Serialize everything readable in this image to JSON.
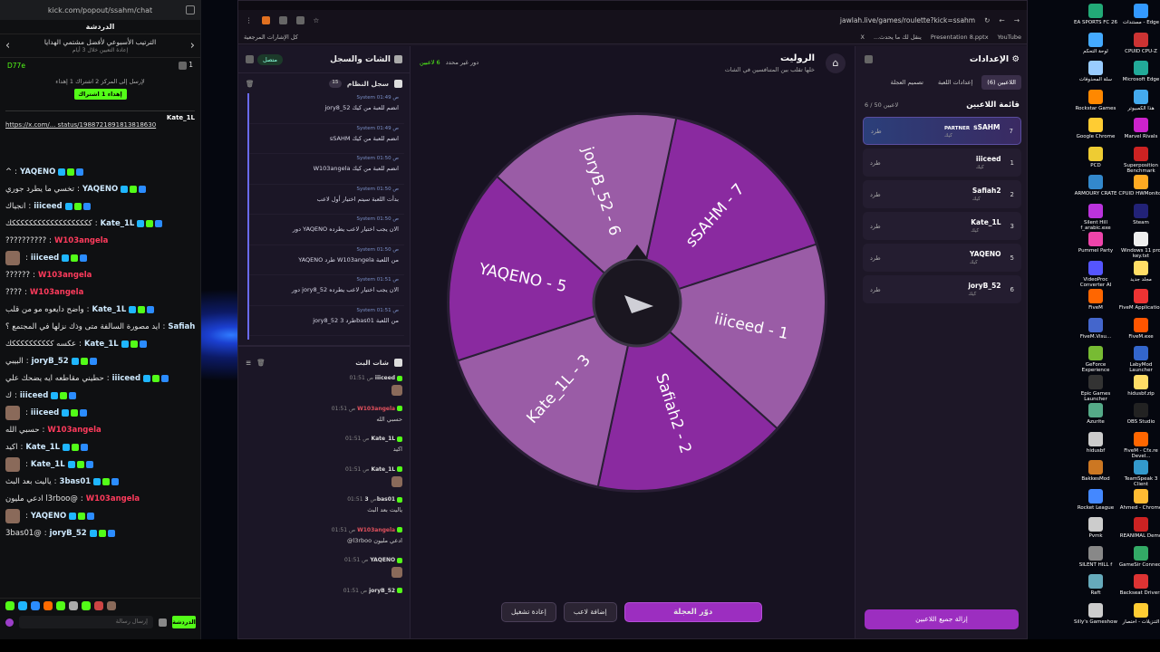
{
  "kick": {
    "url": "kick.com/popout/ssahm/chat",
    "header": "الدردشة",
    "pinned_title": "الترتيب الأسبوعي لأفضل مشتمي الهدايا",
    "pinned_sub": "إعادة التعيين خلال 3 أيام",
    "coin_count": "1",
    "streamer_tag": "D77e",
    "rank_msg": "لإرسل إلى المركز 2 اشتراك 1 إهداء",
    "join_label": "إهداء 1 اشتراك",
    "pinned_user": "Kate_1L",
    "pinned_link": "https://x.com/... status/1988721891813818630",
    "messages": [
      {
        "user": "YAQENO",
        "text": "^",
        "red": false
      },
      {
        "user": "YAQENO",
        "text": "تخسي ما يطرد جوري",
        "red": false
      },
      {
        "user": "iiiceed",
        "text": "انجياك",
        "red": false
      },
      {
        "user": "Kate_1L",
        "text": "كككككككككككككككككككك",
        "red": false
      },
      {
        "user": "W103angela",
        "text": "??????????",
        "red": true
      },
      {
        "user": "iiiceed",
        "text": "",
        "red": false
      },
      {
        "user": "W103angela",
        "text": "??????",
        "red": true
      },
      {
        "user": "W103angela",
        "text": "????",
        "red": true
      },
      {
        "user": "Kate_1L",
        "text": "واضح دايعوه مو من قلب",
        "red": false
      },
      {
        "user": "Safiah2",
        "text": "ايد مصورة السالفة متى وذك نزلها في المجتمع ؟",
        "red": false
      },
      {
        "user": "Kate_1L",
        "text": "عكسه ككككككككككك",
        "red": false
      },
      {
        "user": "joryB_52",
        "text": "البيبي",
        "red": false
      },
      {
        "user": "iiiceed",
        "text": "حطيني مقاطعه ايه يضحك علي",
        "red": false
      },
      {
        "user": "iiiceed",
        "text": "ك",
        "red": false
      },
      {
        "user": "iiiceed",
        "text": "",
        "red": false
      },
      {
        "user": "W103angela",
        "text": "حسبي الله",
        "red": true
      },
      {
        "user": "Kate_1L",
        "text": "اكيد",
        "red": false
      },
      {
        "user": "Kate_1L",
        "text": "",
        "red": false
      },
      {
        "user": "3bas01",
        "text": "ياليت بعد البث",
        "red": false
      },
      {
        "user": "W103angela",
        "text": "@l3rboo ادعي مليون",
        "red": true
      },
      {
        "user": "YAQENO",
        "text": "",
        "red": false
      },
      {
        "user": "joryB_52",
        "text": "@3bas01",
        "red": false
      }
    ],
    "input_placeholder": "إرسال رسالة",
    "send_label": "الدردشة"
  },
  "browser": {
    "url": "jawlah.live/games/roulette?kick=ssahm",
    "bookmarks_left": "كل الإشارات المرجعية",
    "bookmarks": [
      "YouTube",
      "Presentation 8.pptx",
      "ينقل لك ما يحدث...",
      "X"
    ]
  },
  "app": {
    "chat_title": "الشات والسجل",
    "connected": "متصل",
    "system_log_title": "سجل النظام",
    "system_log_count": "15",
    "logs": [
      {
        "meta": "System  01:49 ص",
        "text": "jory8_52 انضم للعبة من كيك"
      },
      {
        "meta": "System  01:49 ص",
        "text": "sSAHM انضم للعبة من كيك"
      },
      {
        "meta": "System  01:50 ص",
        "text": "W103angela انضم للعبة من كيك"
      },
      {
        "meta": "System  01:50 ص",
        "text": "بدأت اللعبة سيتم اختيار أول لاعب"
      },
      {
        "meta": "System  01:50 ص",
        "text": "دور YAQENO الان يجب اختيار لاعب يطرده"
      },
      {
        "meta": "System  01:50 ص",
        "text": "YAQENO طرد W103angela من اللعبة"
      },
      {
        "meta": "System  01:51 ص",
        "text": "دور jory8_52 الان يجب اختيار لاعب يطرده"
      },
      {
        "meta": "System  01:51 ص",
        "text": "jory8_52 طرد 3bas01 من اللعبة"
      }
    ],
    "bot_chat_title": "شات البث",
    "bot_chat": [
      {
        "user": "iiiceed",
        "time": "01:51 ص",
        "text": "",
        "red": false
      },
      {
        "user": "W103angela",
        "time": "01:51 ص",
        "text": "حسبي الله",
        "red": true
      },
      {
        "user": "Kate_1L",
        "time": "01:51 ص",
        "text": "اكيد",
        "red": false
      },
      {
        "user": "Kate_1L",
        "time": "01:51 ص",
        "text": "",
        "red": false
      },
      {
        "user": "3bas01",
        "time": "01:51 ص",
        "text": "ياليت بعد البث",
        "red": false
      },
      {
        "user": "W103angela",
        "time": "01:51 ص",
        "text": "@l3rboo ادعي مليون",
        "red": true
      },
      {
        "user": "YAQENO",
        "time": "01:51 ص",
        "text": "",
        "red": false
      },
      {
        "user": "joryB_52",
        "time": "01:51 ص",
        "text": "@3bas01",
        "red": false
      }
    ],
    "game_title": "الروليت",
    "game_sub": "خلها تقلب بين المتنافسين في الشات",
    "round_info": "دور غير محدد",
    "players_info": "6 لاعبين",
    "wheel": {
      "segments": [
        {
          "label": "sSAHM - 7",
          "color": "#8a2aa0"
        },
        {
          "label": "iiiceed - 1",
          "color": "#9a5ca6"
        },
        {
          "label": "Safiah2 - 2",
          "color": "#8a2aa0"
        },
        {
          "label": "Kate_1L - 3",
          "color": "#9a5ca6"
        },
        {
          "label": "YAQENO - 5",
          "color": "#8a2aa0"
        },
        {
          "label": "joryB_52 - 6",
          "color": "#9a5ca6"
        }
      ]
    },
    "buttons": {
      "restart": "إعادة تشغيل",
      "add_player": "إضافة لاعب",
      "spin": "دوّر العجلة"
    },
    "settings_title": "الإعدادات",
    "tabs": [
      "اللاعبين (6)",
      "إعدادات اللعبة",
      "تصميم العجلة"
    ],
    "player_list_title": "قائمة اللاعبين",
    "player_count": "6 / 50 لاعبين",
    "kick_label": "طرد",
    "players": [
      {
        "name": "sSAHM",
        "num": "7",
        "partner": "PARTNER"
      },
      {
        "name": "iiiceed",
        "num": "1"
      },
      {
        "name": "Safiah2",
        "num": "2"
      },
      {
        "name": "Kate_1L",
        "num": "3"
      },
      {
        "name": "YAQENO",
        "num": "5"
      },
      {
        "name": "joryB_52",
        "num": "6"
      }
    ],
    "kick_tag": "كيك",
    "clear_all": "إزالة جميع اللاعبين"
  },
  "desktop_icons": [
    "EA SPORTS FC 26",
    "مستندات - Edge",
    "لوحة التحكم",
    "CPUID CPU-Z",
    "سلة المحذوفات",
    "Microsoft Edge",
    "Rockstar Games",
    "هذا الكمبيوتر",
    "Google Chrome",
    "Marvel Rivals",
    "PCD",
    "Superposition Benchmark",
    "ARMOURY CRATE",
    "CPUID HWMonitor",
    "Silent Hill f_arabic.exe",
    "Steam",
    "Pummel Party",
    "Windows 11 pro key.txt",
    "VideoProc Converter AI",
    "مجلد جديد",
    "FiveM",
    "FiveM Application",
    "FiveM.Visu...",
    "FiveM.exe",
    "GeForce Experience",
    "LabyMod Launcher",
    "Epic Games Launcher",
    "hidusbf.zip",
    "Azurite",
    "OBS Studio",
    "hidusbf",
    "FiveM - Cfx.re Devel...",
    "BakkesMod",
    "TeamSpeak 3 Client",
    "Rocket League",
    "Ahmed - Chrome",
    "Pvmk",
    "REANIMAL Demo",
    "SILENT HILL f",
    "GameSir Connect",
    "Raft",
    "Backseat Drivers",
    "Silly's Gameshow",
    "التنزيلات - اختصار"
  ]
}
